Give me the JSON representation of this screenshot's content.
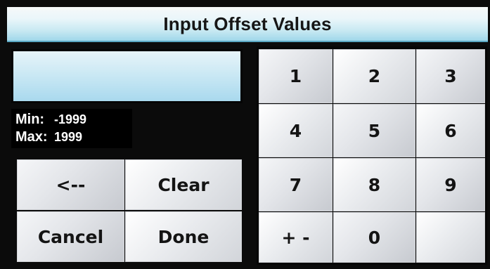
{
  "dialog": {
    "title": "Input Offset Values"
  },
  "display": {
    "value": ""
  },
  "limits": {
    "min_label": "Min:",
    "min_value": "-1999",
    "max_label": "Max:",
    "max_value": "1999"
  },
  "actions": {
    "backspace_label": "<--",
    "clear_label": "Clear",
    "cancel_label": "Cancel",
    "done_label": "Done"
  },
  "keypad": {
    "keys": [
      "1",
      "2",
      "3",
      "4",
      "5",
      "6",
      "7",
      "8",
      "9",
      "+ -",
      "0",
      ""
    ]
  },
  "colors": {
    "title_bar_gradient_end": "#9fd7ea",
    "display_background": "#c5e6f3",
    "button_face": "#e4e6ea",
    "panel_background": "#0b0b0b",
    "limits_text": "#ffffff"
  }
}
